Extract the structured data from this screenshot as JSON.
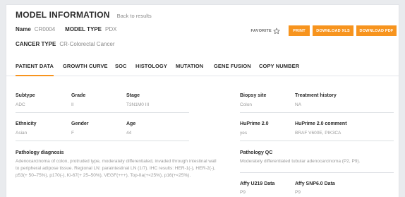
{
  "header": {
    "title": "MODEL INFORMATION",
    "back_link": "Back to results",
    "name_label": "Name",
    "name_value": "CR0004",
    "model_type_label": "MODEL TYPE",
    "model_type_value": "PDX",
    "cancer_type_label": "CANCER TYPE",
    "cancer_type_value": "CR-Colorectal Cancer"
  },
  "actions": {
    "favorite_label": "FAVORITE",
    "print_label": "PRINT",
    "xls_label": "DOWNLOAD XLS",
    "pdf_label": "DOWNLOAD PDF"
  },
  "tabs": [
    {
      "label": "PATIENT DATA",
      "active": true
    },
    {
      "label": "GROWTH CURVE"
    },
    {
      "label": "SOC"
    },
    {
      "label": "HISTOLOGY"
    },
    {
      "label": "MUTATION"
    },
    {
      "label": "GENE FUSION"
    },
    {
      "label": "COPY NUMBER"
    }
  ],
  "patient": {
    "subtype_label": "Subtype",
    "subtype_value": "ADC",
    "grade_label": "Grade",
    "grade_value": "II",
    "stage_label": "Stage",
    "stage_value": "T3N1M0 III",
    "biopsy_label": "Biopsy site",
    "biopsy_value": "Colon",
    "treatment_label": "Treatment history",
    "treatment_value": "NA",
    "ethnicity_label": "Ethnicity",
    "ethnicity_value": "Asian",
    "gender_label": "Gender",
    "gender_value": "F",
    "age_label": "Age",
    "age_value": "44",
    "huprime_label": "HuPrime 2.0",
    "huprime_value": "yes",
    "huprime_comment_label": "HuPrime 2.0 comment",
    "huprime_comment_value": "BRAF V600E, PIK3CA",
    "pathology_label": "Pathology diagnosis",
    "pathology_value": "Adenocarcinoma of colon, protruded type, moderately differentiated, invaded through intestinal wall to peripheral adipose tissue. Regional LN: paraintestinal LN (1/7). IHC results: HER-1(-), HER-2(-), p53(+ 50–75%), p170(-), Ki-67(+ 25–50%), VEGF(+++), Top-IIa(+<25%), p16(+<25%).",
    "pathology_qc_label": "Pathology QC",
    "pathology_qc_value": "Moderately differentiated tubular adenocarcinoma (P2, P9).",
    "affy_u219_label": "Affy U219 Data",
    "affy_u219_value": "P9",
    "affy_snp_label": "Affy SNP6.0 Data",
    "affy_snp_value": "P9"
  }
}
